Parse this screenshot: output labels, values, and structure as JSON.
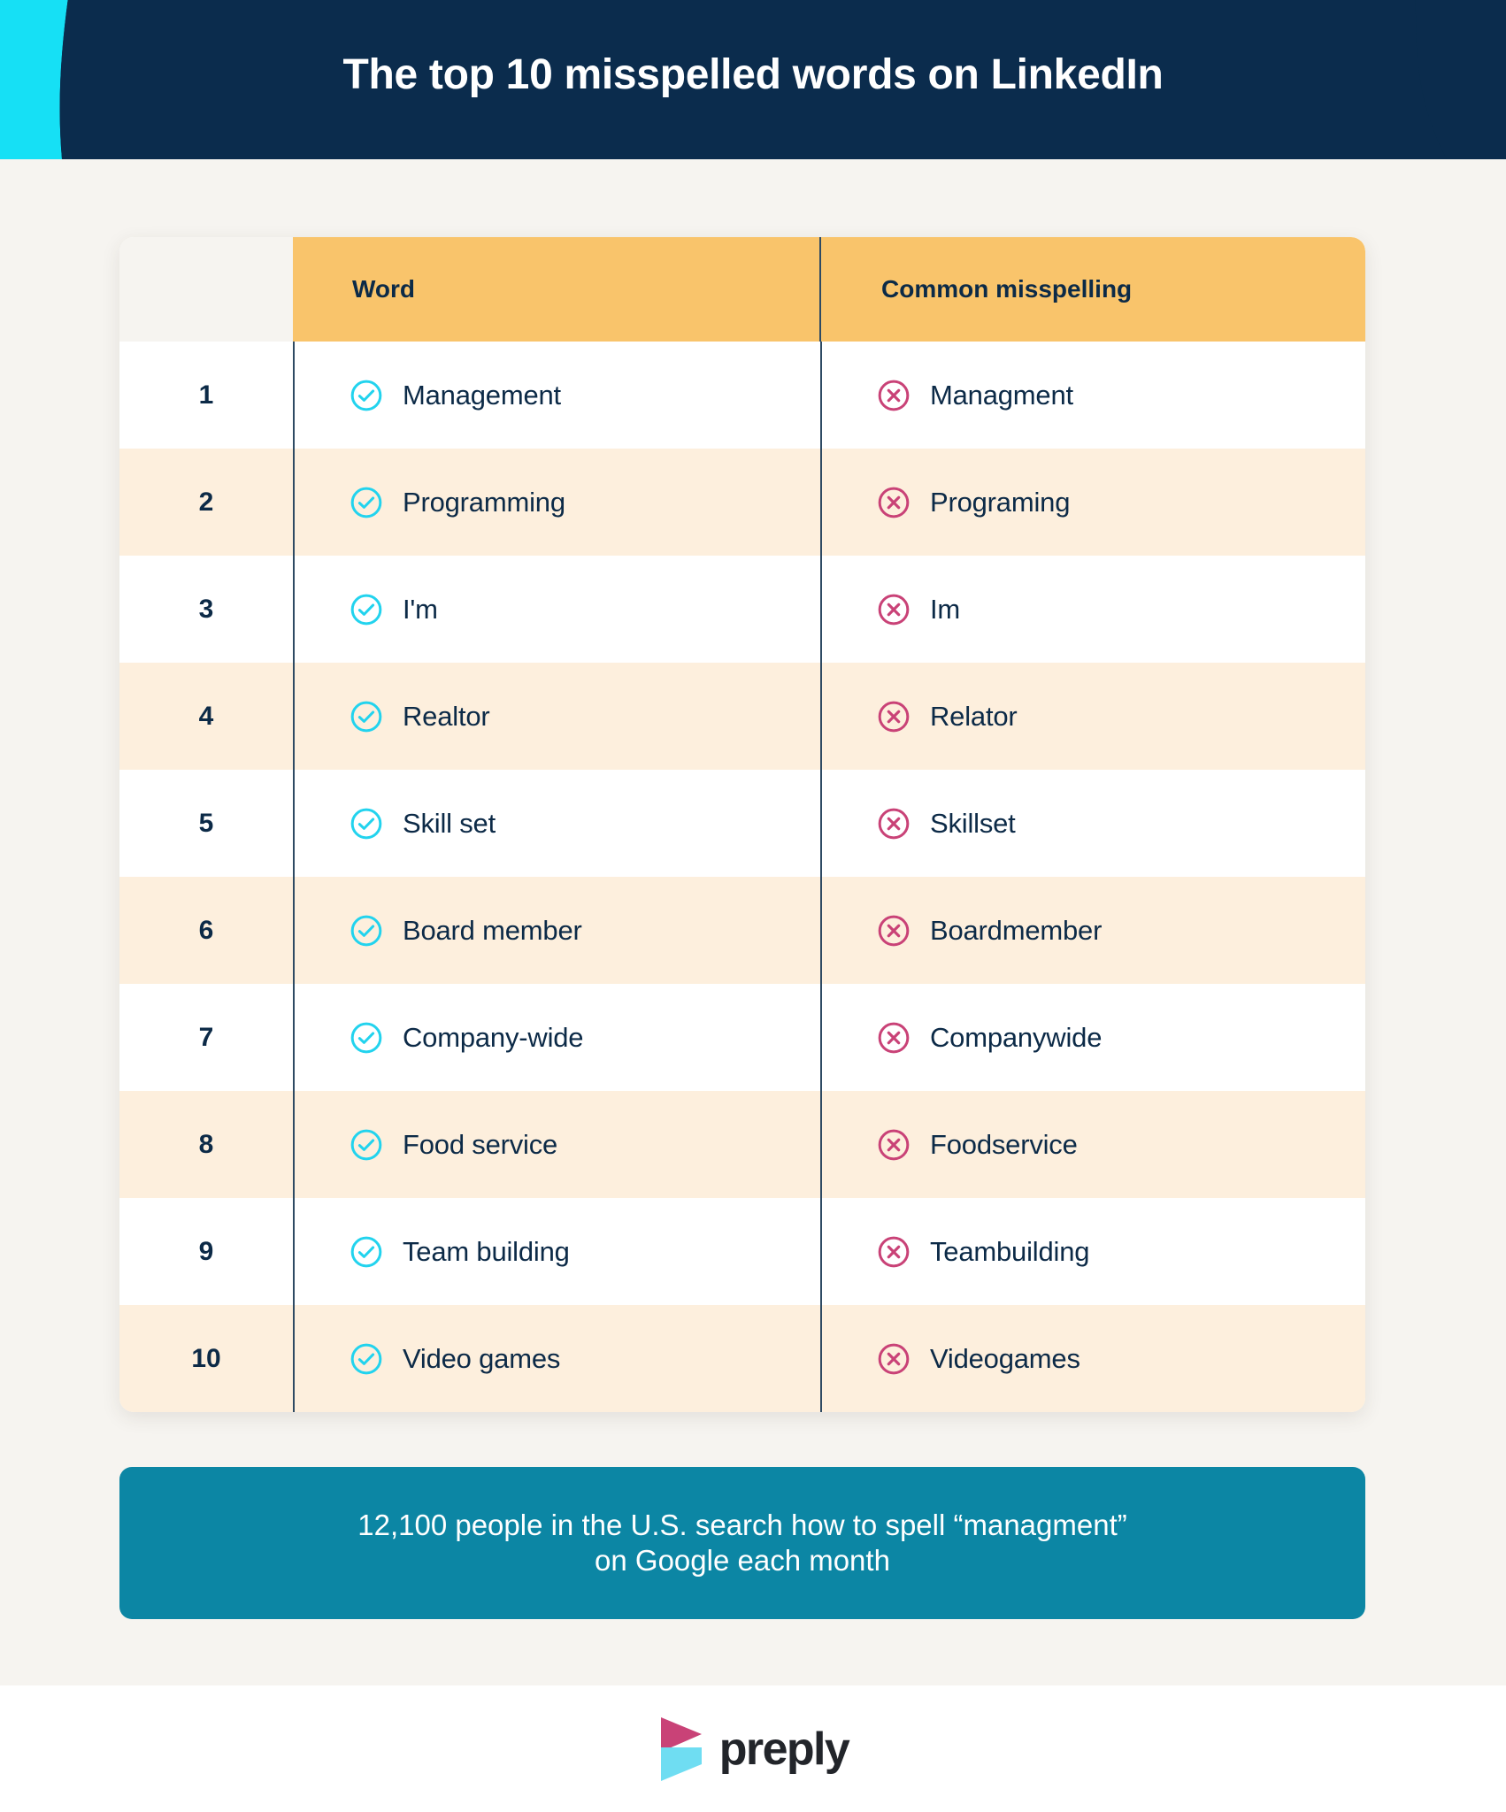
{
  "header": {
    "title": "The top 10 misspelled words on LinkedIn",
    "background_color": "#0B2C4D",
    "accent_color": "#16E0F5",
    "title_color": "#FFFFFF"
  },
  "table": {
    "columns": [
      "Word",
      "Common misspelling"
    ],
    "header_background": "#F9C46B",
    "header_text_color": "#0C2A47",
    "alt_row_background": "#FDEFDD",
    "row_background": "#FFFFFF",
    "correct_icon": "check-circle-icon",
    "correct_icon_color": "#22D3EE",
    "incorrect_icon": "x-circle-icon",
    "incorrect_icon_color": "#C94277",
    "rows": [
      {
        "rank": "1",
        "word": "Management",
        "misspelling": "Managment"
      },
      {
        "rank": "2",
        "word": "Programming",
        "misspelling": "Programing"
      },
      {
        "rank": "3",
        "word": "I'm",
        "misspelling": "Im"
      },
      {
        "rank": "4",
        "word": "Realtor",
        "misspelling": "Relator"
      },
      {
        "rank": "5",
        "word": "Skill set",
        "misspelling": "Skillset"
      },
      {
        "rank": "6",
        "word": "Board member",
        "misspelling": "Boardmember"
      },
      {
        "rank": "7",
        "word": "Company-wide",
        "misspelling": "Companywide"
      },
      {
        "rank": "8",
        "word": "Food service",
        "misspelling": "Foodservice"
      },
      {
        "rank": "9",
        "word": "Team building",
        "misspelling": "Teambuilding"
      },
      {
        "rank": "10",
        "word": "Video games",
        "misspelling": "Videogames"
      }
    ]
  },
  "callout": {
    "line1": "12,100 people in the U.S. search how to spell “managment”",
    "line2": "on Google each month",
    "background_color": "#0C86A4",
    "text_color": "#FFFFFF"
  },
  "footer": {
    "logo_text": "preply",
    "logo_mark": "preply-play-mark-icon",
    "logo_top_color": "#C94277",
    "logo_bottom_color": "#6FDDF2",
    "logo_text_color": "#22252A"
  }
}
